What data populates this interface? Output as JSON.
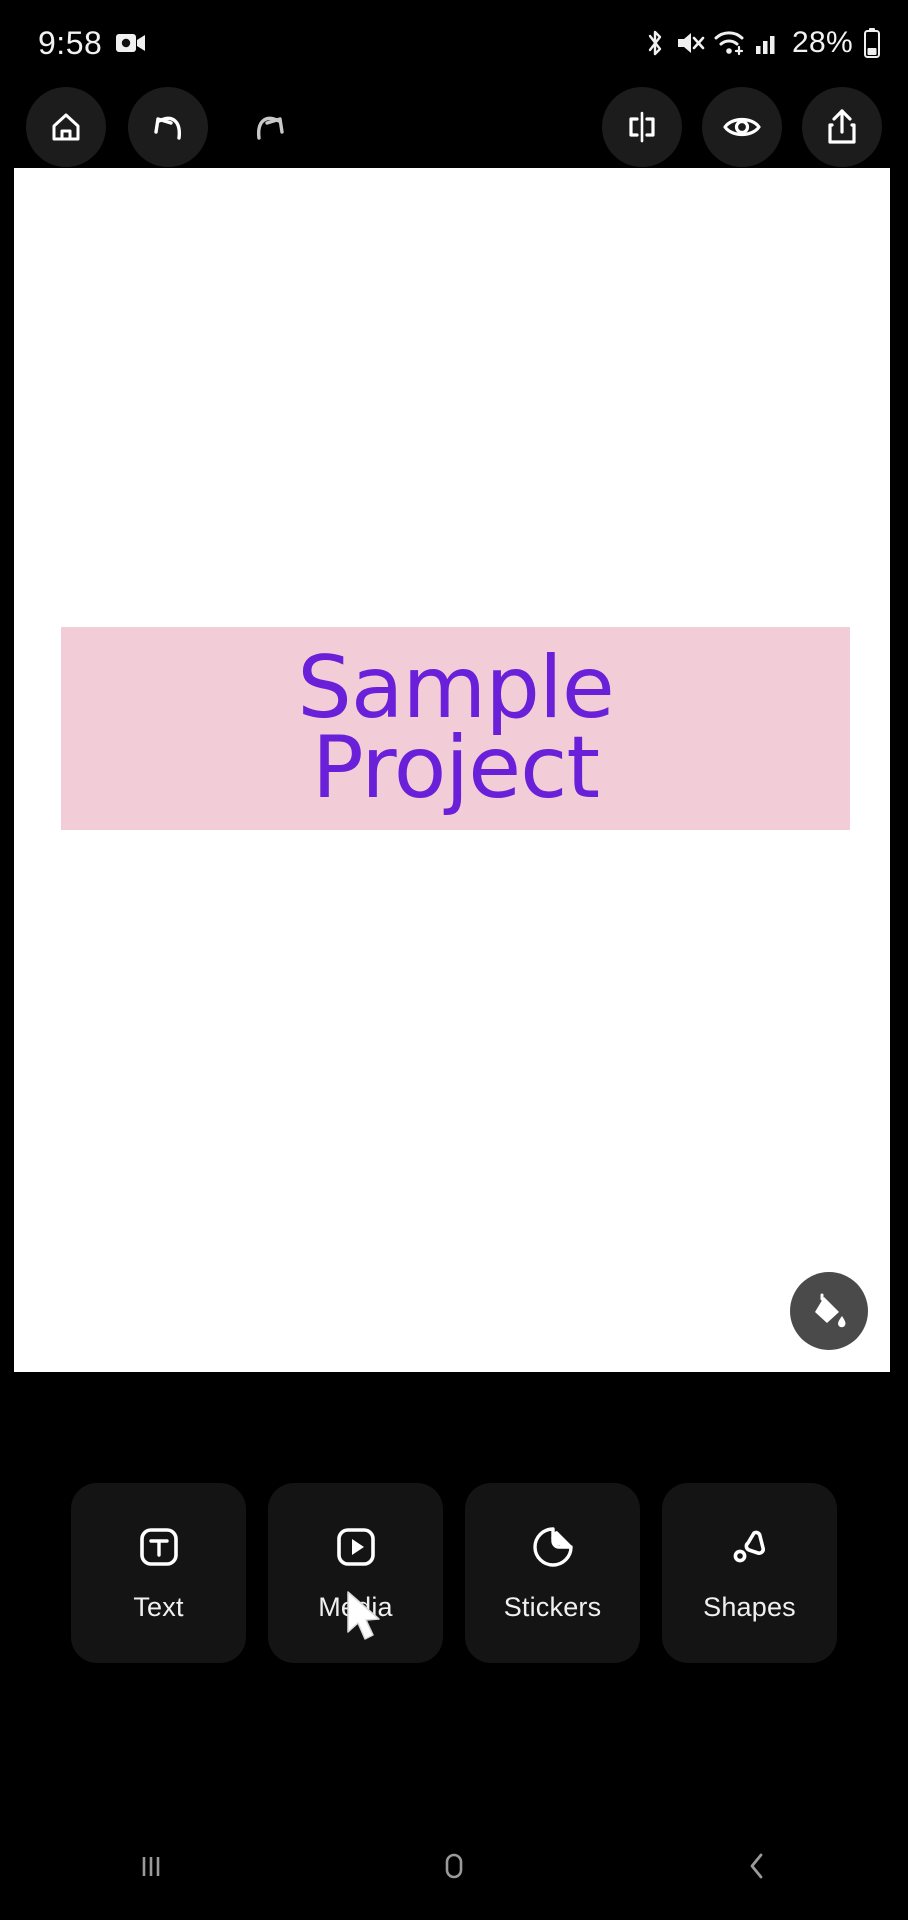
{
  "status_bar": {
    "time": "9:58",
    "battery_percent": "28%",
    "icons": [
      "video-recording-icon",
      "bluetooth-icon",
      "mute-icon",
      "wifi-icon",
      "cellular-signal-icon",
      "battery-icon"
    ]
  },
  "toolbar": {
    "home_label": "Home",
    "undo_label": "Undo",
    "redo_label": "Redo",
    "flip_label": "Flip",
    "preview_label": "Preview",
    "share_label": "Share",
    "icons": [
      "home-icon",
      "undo-icon",
      "redo-icon",
      "flip-horizontal-icon",
      "eye-icon",
      "share-icon"
    ]
  },
  "canvas": {
    "background_color": "#ffffff",
    "text_element": {
      "content": "Sample\nProject",
      "text_color": "#6a20d8",
      "highlight_color": "#f2cdd7"
    },
    "fill_button": {
      "label": "Fill",
      "icon": "paint-bucket-icon",
      "background_color": "#4a4a4a"
    }
  },
  "tools": [
    {
      "label": "Text",
      "icon": "text-box-icon"
    },
    {
      "label": "Media",
      "icon": "media-play-icon"
    },
    {
      "label": "Stickers",
      "icon": "sticker-icon"
    },
    {
      "label": "Shapes",
      "icon": "shapes-icon"
    }
  ],
  "nav_bar": {
    "recents_label": "Recents",
    "home_label": "Home",
    "back_label": "Back"
  }
}
